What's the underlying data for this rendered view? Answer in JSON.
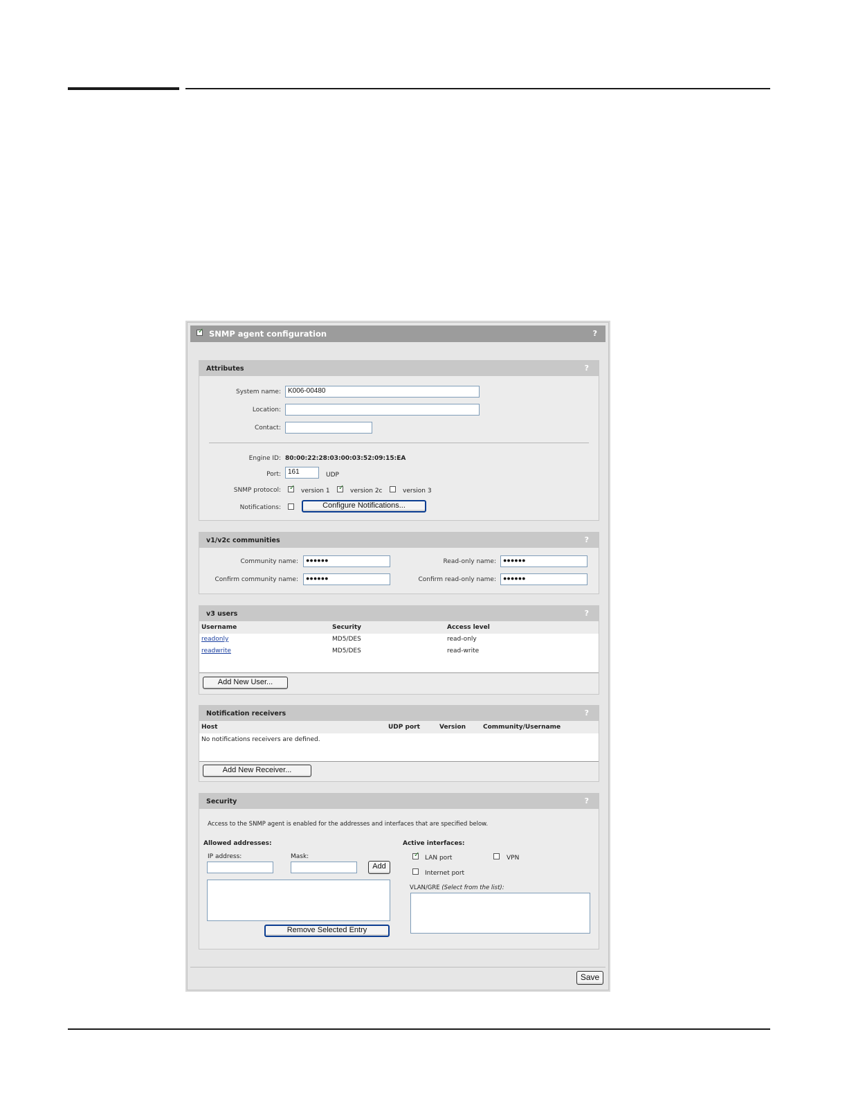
{
  "panel": {
    "title": "SNMP agent configuration",
    "help": "?",
    "enabled": true
  },
  "attributes": {
    "title": "Attributes",
    "help": "?",
    "system_name_label": "System name:",
    "system_name_value": "K006-00480",
    "location_label": "Location:",
    "location_value": "",
    "contact_label": "Contact:",
    "contact_value": "",
    "engine_id_label": "Engine ID:",
    "engine_id_value": "80:00:22:28:03:00:03:52:09:15:EA",
    "port_label": "Port:",
    "port_value": "161",
    "port_unit": "UDP",
    "snmp_protocol_label": "SNMP protocol:",
    "version1_label": "version 1",
    "version1_checked": true,
    "version2c_label": "version 2c",
    "version2c_checked": true,
    "version3_label": "version 3",
    "version3_checked": false,
    "notifications_label": "Notifications:",
    "notifications_checked": false,
    "configure_button": "Configure Notifications..."
  },
  "communities": {
    "title": "v1/v2c communities",
    "help": "?",
    "community_name_label": "Community name:",
    "community_name_value": "●●●●●●",
    "confirm_community_label": "Confirm community name:",
    "confirm_community_value": "●●●●●●",
    "readonly_name_label": "Read-only name:",
    "readonly_name_value": "●●●●●●",
    "confirm_readonly_label": "Confirm read-only name:",
    "confirm_readonly_value": "●●●●●●"
  },
  "v3_users": {
    "title": "v3 users",
    "help": "?",
    "columns": [
      "Username",
      "Security",
      "Access level"
    ],
    "rows": [
      {
        "username": "readonly",
        "security": "MD5/DES",
        "access": "read-only"
      },
      {
        "username": "readwrite",
        "security": "MD5/DES",
        "access": "read-write"
      }
    ],
    "add_button": "Add New User..."
  },
  "receivers": {
    "title": "Notification receivers",
    "help": "?",
    "columns": [
      "Host",
      "UDP port",
      "Version",
      "Community/Username"
    ],
    "empty_message": "No notifications receivers are defined.",
    "add_button": "Add New Receiver..."
  },
  "security": {
    "title": "Security",
    "help": "?",
    "description": "Access to the SNMP agent is enabled for the addresses and interfaces that are specified below.",
    "allowed_label": "Allowed addresses:",
    "ip_label": "IP address:",
    "mask_label": "Mask:",
    "add_button": "Add",
    "remove_button": "Remove Selected Entry",
    "active_label": "Active interfaces:",
    "lan_label": "LAN port",
    "lan_checked": true,
    "vpn_label": "VPN",
    "vpn_checked": false,
    "internet_label": "Internet port",
    "internet_checked": false,
    "vlan_label": "VLAN/GRE",
    "vlan_hint": "(Select from the list):"
  },
  "footer": {
    "save_button": "Save"
  }
}
